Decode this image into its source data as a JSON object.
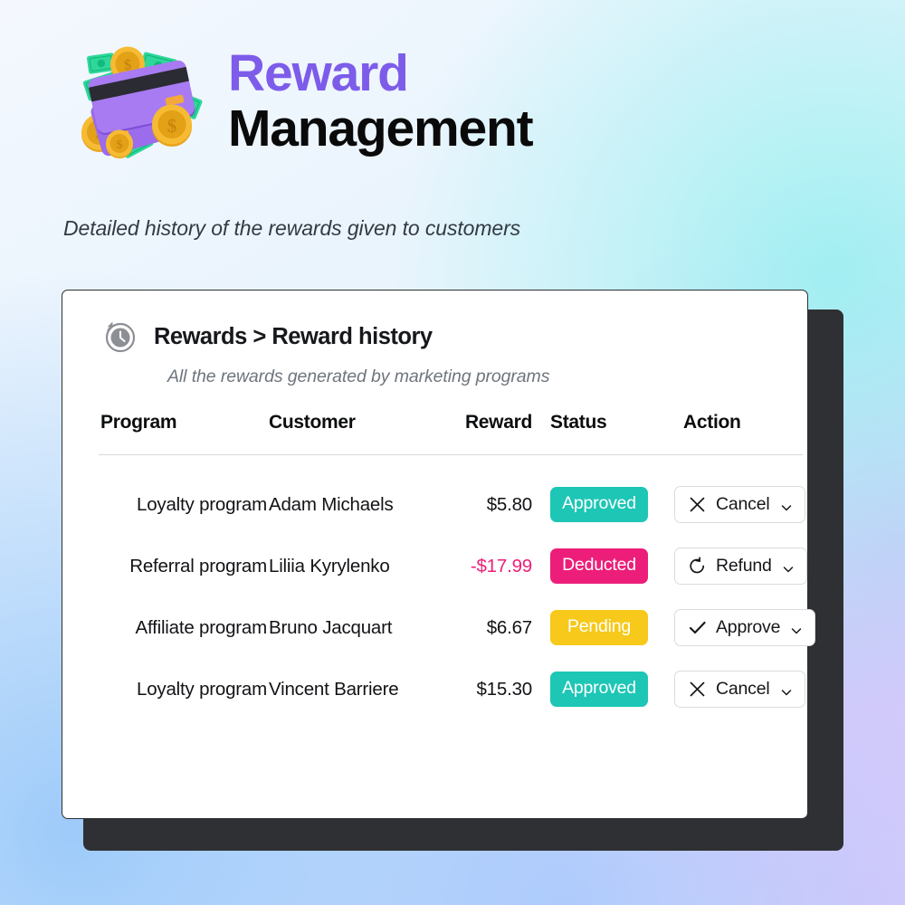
{
  "header": {
    "title_line1": "Reward",
    "title_line2": "Management",
    "subtitle": "Detailed history of the rewards given to customers",
    "title_color_1": "#7d5cea",
    "title_color_2": "#0a0a0a",
    "logo_icon": "credit-cards-coins-money-3d-illustration"
  },
  "card": {
    "icon": "history-clock-icon",
    "breadcrumb": "Rewards > Reward history",
    "subtitle": "All the rewards generated by marketing programs",
    "columns": [
      "Program",
      "Customer",
      "Reward",
      "Status",
      "Action"
    ],
    "rows": [
      {
        "program": "Loyalty program",
        "customer": "Adam Michaels",
        "reward": "$5.80",
        "reward_negative": false,
        "status": "Approved",
        "status_class": "approved",
        "status_color": "#1ec6b6",
        "action_label": "Cancel",
        "action_icon": "close-x-icon"
      },
      {
        "program": "Referral program",
        "customer": "Liliia Kyrylenko",
        "reward": "-$17.99",
        "reward_negative": true,
        "status": "Deducted",
        "status_class": "deducted",
        "status_color": "#ec1e79",
        "action_label": "Refund",
        "action_icon": "undo-arrow-icon"
      },
      {
        "program": "Affiliate program",
        "customer": "Bruno Jacquart",
        "reward": "$6.67",
        "reward_negative": false,
        "status": "Pending",
        "status_class": "pending",
        "status_color": "#f6c91b",
        "action_label": "Approve",
        "action_icon": "check-icon"
      },
      {
        "program": "Loyalty program",
        "customer": "Vincent Barriere",
        "reward": "$15.30",
        "reward_negative": false,
        "status": "Approved",
        "status_class": "approved",
        "status_color": "#1ec6b6",
        "action_label": "Cancel",
        "action_icon": "close-x-icon"
      }
    ],
    "action_dropdown_icon": "chevron-down-icon"
  }
}
